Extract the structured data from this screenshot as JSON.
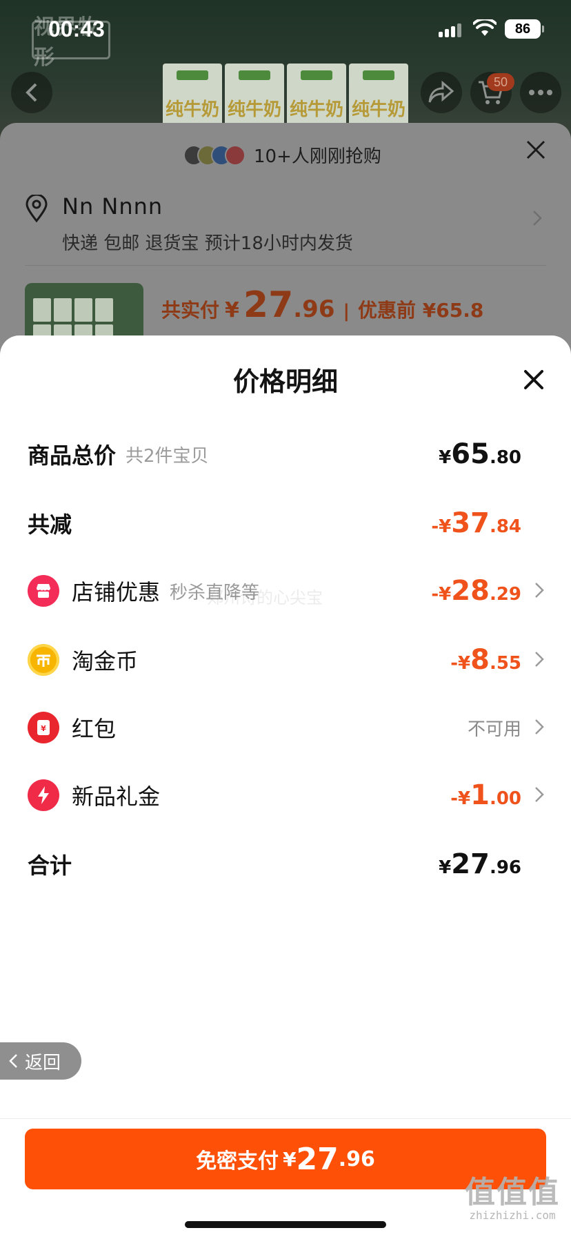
{
  "status_bar": {
    "time": "00:43",
    "battery": "86"
  },
  "background": {
    "logo_text": "视界牧形",
    "product_mark": "纯牛奶",
    "cart_count": "50"
  },
  "order_sheet": {
    "buyers_text": "10+人刚刚抢购",
    "address_name": "Nn Nnnn",
    "shipping": "快递 包邮 退货宝 预计18小时内发货",
    "pay_label": "共实付",
    "pay_yen": "¥",
    "pay_int": "27",
    "pay_dec": ".96",
    "separator": "|",
    "pre_discount": "优惠前 ¥65.8"
  },
  "price_detail": {
    "title": "价格明细",
    "rows": [
      {
        "label": "商品总价",
        "sub": "共2件宝贝",
        "sign": "¥",
        "int": "65",
        "dec": ".80"
      },
      {
        "label": "共减",
        "sign": "-¥",
        "int": "37",
        "dec": ".84"
      },
      {
        "label": "店铺优惠",
        "sub": "秒杀直降等",
        "sign": "-¥",
        "int": "28",
        "dec": ".29",
        "icon": "store-icon"
      },
      {
        "label": "淘金币",
        "sign": "-¥",
        "int": "8",
        "dec": ".55",
        "icon": "coin-icon"
      },
      {
        "label": "红包",
        "status": "不可用",
        "icon": "red-packet-icon"
      },
      {
        "label": "新品礼金",
        "sign": "-¥",
        "int": "1",
        "dec": ".00",
        "icon": "lightning-icon"
      },
      {
        "label": "合计",
        "sign": "¥",
        "int": "27",
        "dec": ".96"
      }
    ],
    "watermark": "郑州诗的心尖宝"
  },
  "back_button": {
    "label": "返回"
  },
  "pay_button": {
    "label": "免密支付",
    "sign": "¥",
    "int": "27",
    "dec": ".96"
  },
  "site_watermark": {
    "big": "值值值",
    "small": "zhizhizhi.com"
  },
  "colors": {
    "accent": "#ff5008",
    "discount": "#f0521b"
  }
}
